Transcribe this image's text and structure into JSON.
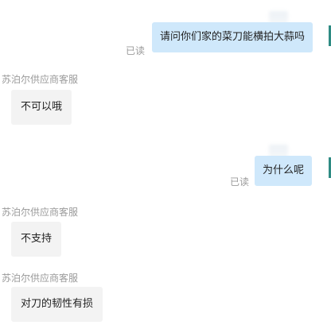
{
  "messages": [
    {
      "type": "out",
      "text": "请问你们家的菜刀能横拍大蒜吗",
      "status": "已读"
    },
    {
      "type": "in",
      "sender": "苏泊尔供应商客服",
      "text": "不可以哦"
    },
    {
      "type": "out",
      "text": "为什么呢",
      "status": "已读"
    },
    {
      "type": "in",
      "sender": "苏泊尔供应商客服",
      "text": "不支持"
    },
    {
      "type": "in",
      "sender": "苏泊尔供应商客服",
      "text": "对刀的韧性有损"
    }
  ],
  "colors": {
    "outgoing_bubble": "#cfe8fb",
    "incoming_bubble": "#f3f3f3",
    "meta_text": "#9a9a9a",
    "accent_edge": "#2e8b83"
  }
}
